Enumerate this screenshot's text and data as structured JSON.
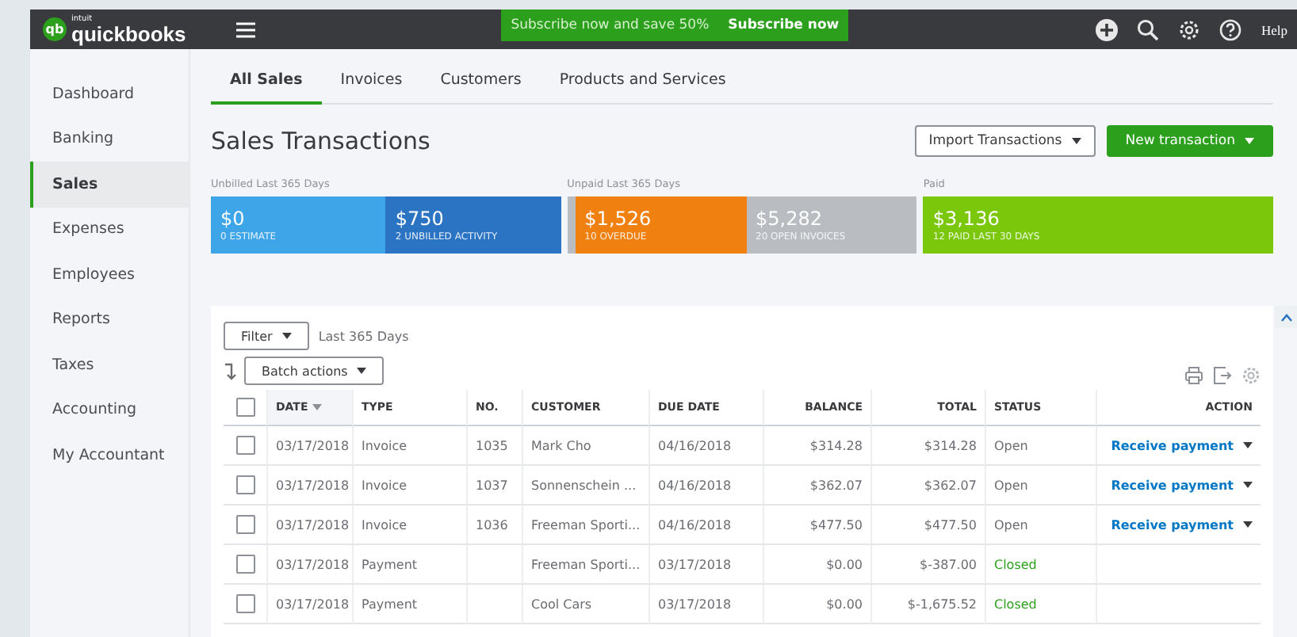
{
  "app": {
    "mark": "qb",
    "maker": "intuit",
    "name": "quickbooks"
  },
  "promo": {
    "text": "Subscribe now and save 50%",
    "link": "Subscribe now"
  },
  "topbar": {
    "help": "Help"
  },
  "sidebar": {
    "items": [
      {
        "label": "Dashboard",
        "selected": false
      },
      {
        "label": "Banking",
        "selected": false
      },
      {
        "label": "Sales",
        "selected": true
      },
      {
        "label": "Expenses",
        "selected": false
      },
      {
        "label": "Employees",
        "selected": false
      },
      {
        "label": "Reports",
        "selected": false
      },
      {
        "label": "Taxes",
        "selected": false
      },
      {
        "label": "Accounting",
        "selected": false
      },
      {
        "label": "My Accountant",
        "selected": false
      }
    ]
  },
  "tabs": [
    {
      "label": "All Sales",
      "selected": true
    },
    {
      "label": "Invoices",
      "selected": false
    },
    {
      "label": "Customers",
      "selected": false
    },
    {
      "label": "Products and Services",
      "selected": false
    }
  ],
  "page_title": "Sales Transactions",
  "actions": {
    "import": "Import Transactions",
    "new": "New transaction"
  },
  "summary": [
    {
      "label": "Unbilled Last 365 Days",
      "segments": [
        {
          "amount": "$0",
          "caption": "0 ESTIMATE",
          "color": "#3da5e8"
        },
        {
          "amount": "$750",
          "caption": "2 UNBILLED ACTIVITY",
          "color": "#2b74c4"
        }
      ]
    },
    {
      "label": "Unpaid Last 365 Days",
      "segments": [
        {
          "amount": "$1,526",
          "caption": "10 OVERDUE",
          "color": "#f08010"
        },
        {
          "amount": "$5,282",
          "caption": "20 OPEN INVOICES",
          "color": "#b9bcc0"
        }
      ]
    },
    {
      "label": "Paid",
      "segments": [
        {
          "amount": "$3,136",
          "caption": "12 PAID LAST 30 DAYS",
          "color": "#7ac70c"
        }
      ]
    }
  ],
  "filter": {
    "button": "Filter",
    "range": "Last 365 Days"
  },
  "batch": "Batch actions",
  "table": {
    "all_checked": false,
    "columns": [
      "DATE",
      "TYPE",
      "NO.",
      "CUSTOMER",
      "DUE DATE",
      "BALANCE",
      "TOTAL",
      "STATUS",
      "ACTION"
    ],
    "rows": [
      {
        "checked": false,
        "date": "03/17/2018",
        "type": "Invoice",
        "no": "1035",
        "customer": "Mark Cho",
        "due": "04/16/2018",
        "balance": "$314.28",
        "total": "$314.28",
        "status": "Open",
        "closed": false,
        "action": "Receive payment"
      },
      {
        "checked": false,
        "date": "03/17/2018",
        "type": "Invoice",
        "no": "1037",
        "customer": "Sonnenschein ...",
        "due": "04/16/2018",
        "balance": "$362.07",
        "total": "$362.07",
        "status": "Open",
        "closed": false,
        "action": "Receive payment"
      },
      {
        "checked": false,
        "date": "03/17/2018",
        "type": "Invoice",
        "no": "1036",
        "customer": "Freeman Sporti...",
        "due": "04/16/2018",
        "balance": "$477.50",
        "total": "$477.50",
        "status": "Open",
        "closed": false,
        "action": "Receive payment"
      },
      {
        "checked": false,
        "date": "03/17/2018",
        "type": "Payment",
        "customer": "Freeman Sporti...",
        "due": "03/17/2018",
        "balance": "$0.00",
        "total": "$-387.00",
        "status": "Closed",
        "closed": true
      },
      {
        "checked": false,
        "date": "03/17/2018",
        "type": "Payment",
        "customer": "Cool Cars",
        "due": "03/17/2018",
        "balance": "$0.00",
        "total": "$-1,675.52",
        "status": "Closed",
        "closed": true
      }
    ]
  }
}
